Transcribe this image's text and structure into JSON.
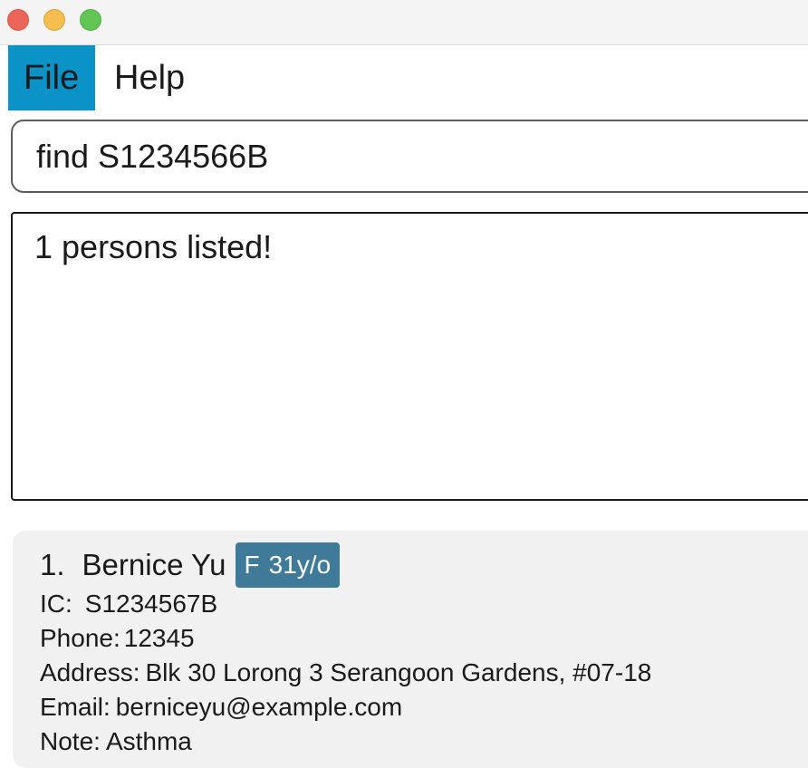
{
  "window": {
    "controls": [
      "close",
      "minimize",
      "maximize"
    ]
  },
  "menu": {
    "file_label": "File",
    "help_label": "Help",
    "active": "File",
    "accent_color": "#0b93c8"
  },
  "command": {
    "value": "find S1234566B"
  },
  "result": {
    "message": "1 persons listed!"
  },
  "person": {
    "index": "1.",
    "name": "Bernice Yu",
    "sex": "F",
    "age": "31y/o",
    "tag_color": "#3f7b98",
    "ic_label": "IC:",
    "ic": "S1234567B",
    "phone_label": "Phone:",
    "phone": "12345",
    "address_label": "Address:",
    "address": "Blk 30 Lorong 3 Serangoon Gardens, #07-18",
    "email_label": "Email:",
    "email": "berniceyu@example.com",
    "note_label": "Note:",
    "note": "Asthma"
  }
}
